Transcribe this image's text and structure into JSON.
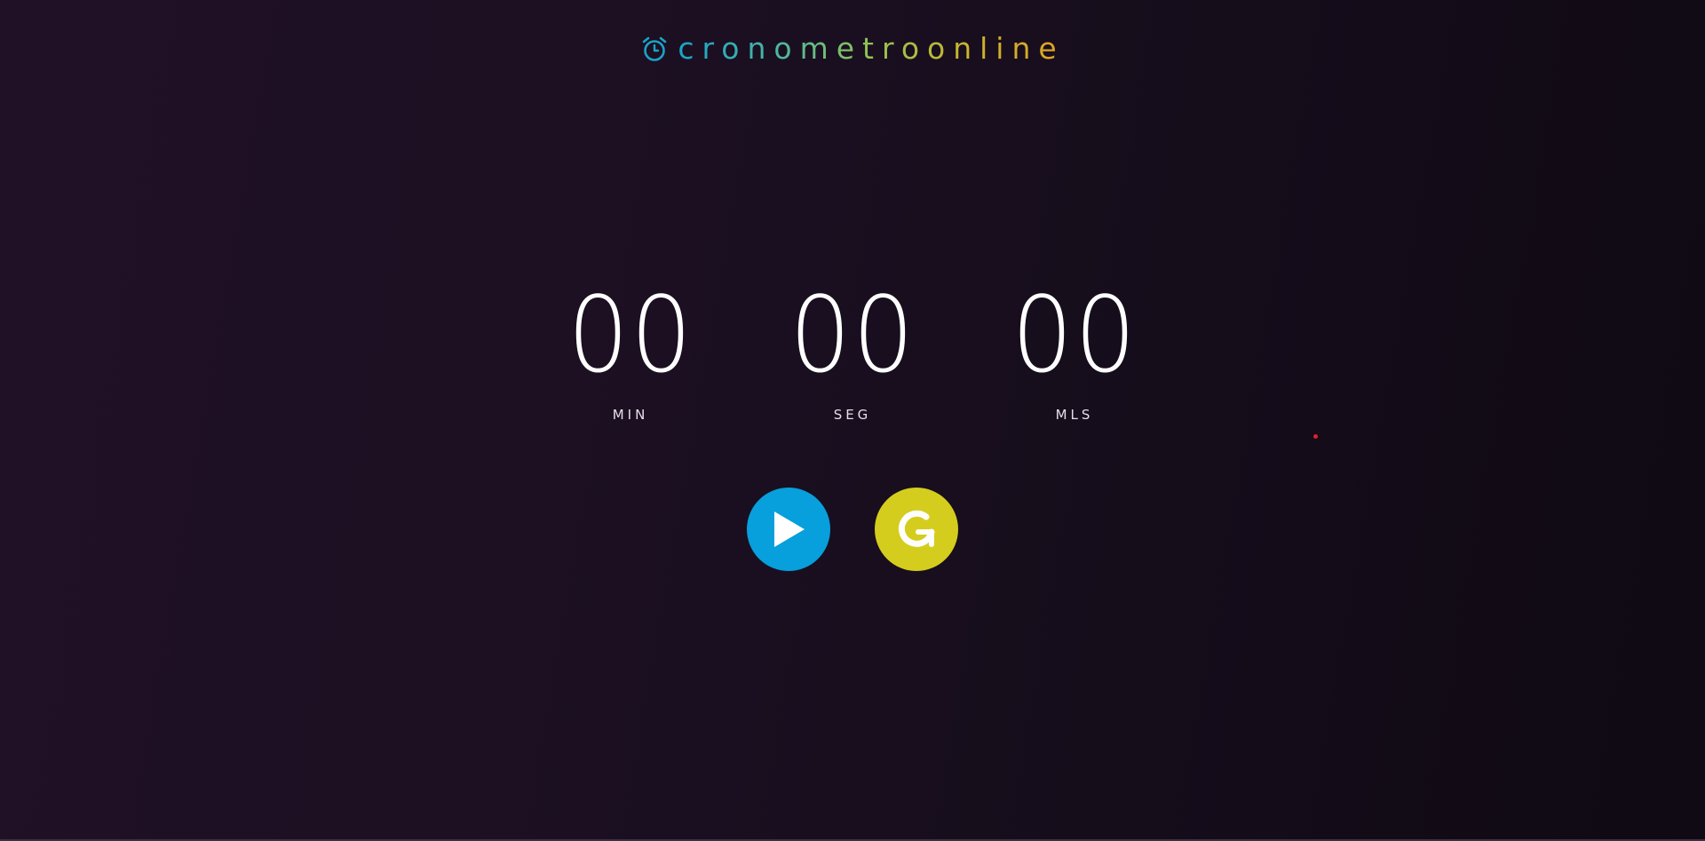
{
  "brand": {
    "name": "cronometroonline",
    "icon": "alarm-clock-icon",
    "gradient": [
      "#1aa3c9",
      "#93c253",
      "#e0a224"
    ]
  },
  "timer": {
    "minutes": {
      "value": "00",
      "label": "MIN"
    },
    "seconds": {
      "value": "00",
      "label": "SEG"
    },
    "milliseconds": {
      "value": "00",
      "label": "MLS"
    }
  },
  "controls": {
    "play": {
      "icon": "play-icon",
      "color": "#079fdc"
    },
    "reset": {
      "icon": "reset-icon",
      "color": "#d4cd1d"
    }
  },
  "colors": {
    "background_start": "#211127",
    "background_end": "#0f0a13",
    "digits": "#ffffff"
  }
}
